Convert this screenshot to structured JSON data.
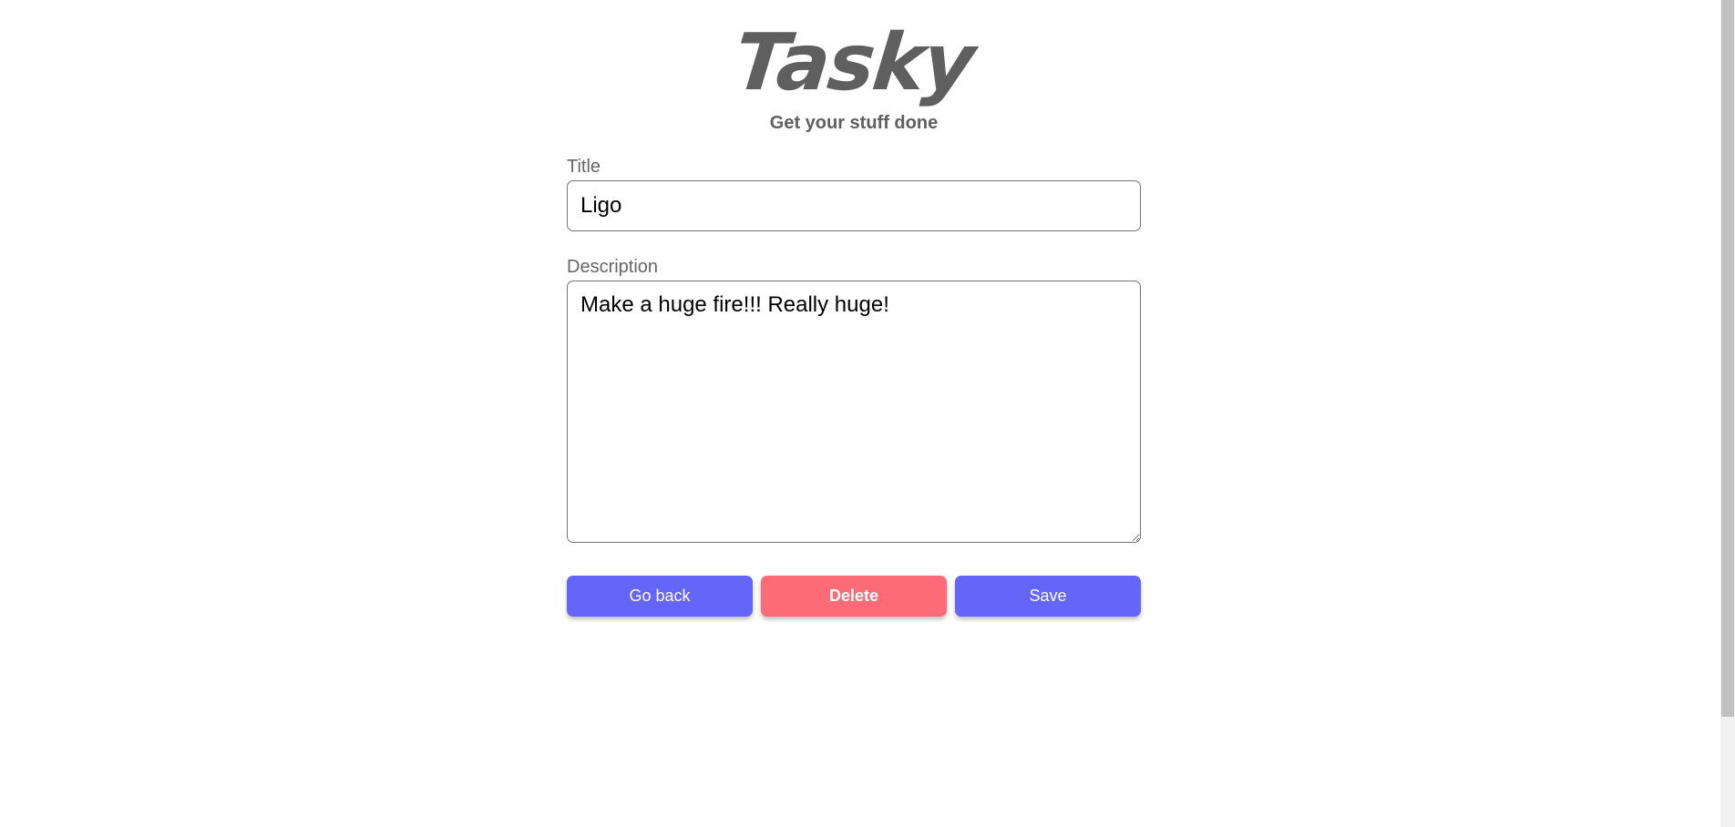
{
  "app": {
    "logo_text": "Tasky",
    "subtitle": "Get your stuff done"
  },
  "form": {
    "title_label": "Title",
    "title_value": "Ligo",
    "description_label": "Description",
    "description_value": "Make a huge fire!!! Really huge!"
  },
  "actions": {
    "go_back_label": "Go back",
    "delete_label": "Delete",
    "save_label": "Save"
  },
  "colors": {
    "primary": "#6366f9",
    "danger": "#fd6c76",
    "heading": "#5f5f5f"
  }
}
